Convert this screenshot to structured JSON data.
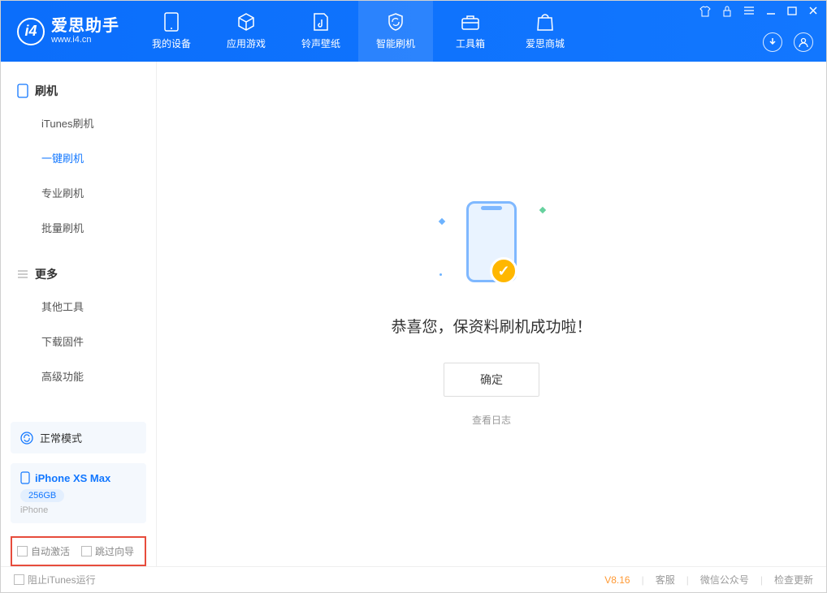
{
  "app": {
    "name_cn": "爱思助手",
    "name_en": "www.i4.cn"
  },
  "nav": {
    "items": [
      {
        "label": "我的设备"
      },
      {
        "label": "应用游戏"
      },
      {
        "label": "铃声壁纸"
      },
      {
        "label": "智能刷机"
      },
      {
        "label": "工具箱"
      },
      {
        "label": "爱思商城"
      }
    ]
  },
  "sidebar": {
    "section1_title": "刷机",
    "section1_items": [
      "iTunes刷机",
      "一键刷机",
      "专业刷机",
      "批量刷机"
    ],
    "section2_title": "更多",
    "section2_items": [
      "其他工具",
      "下载固件",
      "高级功能"
    ]
  },
  "device": {
    "mode_label": "正常模式",
    "name": "iPhone XS Max",
    "storage": "256GB",
    "type": "iPhone"
  },
  "checkboxes": {
    "auto_activate": "自动激活",
    "skip_guide": "跳过向导"
  },
  "main": {
    "success_text": "恭喜您，保资料刷机成功啦！",
    "ok_button": "确定",
    "view_log": "查看日志"
  },
  "footer": {
    "block_itunes": "阻止iTunes运行",
    "version": "V8.16",
    "links": [
      "客服",
      "微信公众号",
      "检查更新"
    ]
  }
}
